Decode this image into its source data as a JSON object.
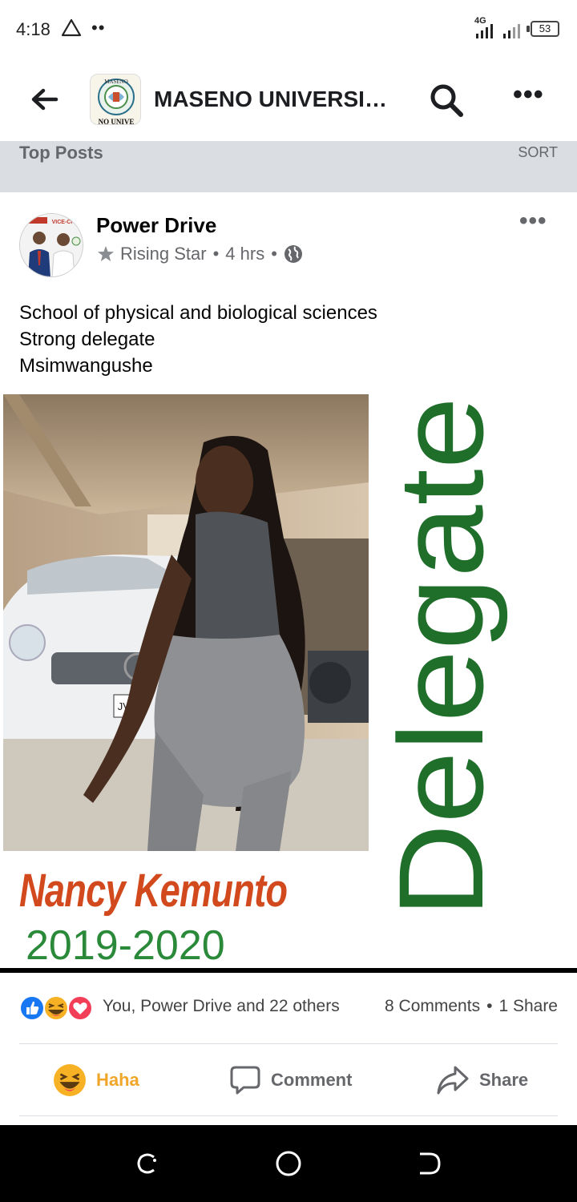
{
  "status_bar": {
    "time": "4:18",
    "dots": "••",
    "network": "4G",
    "battery": "53"
  },
  "header": {
    "title": "MASENO UNIVERSIT…",
    "logo_text_top": "MASENO",
    "logo_text_bottom": "NO UNIVE",
    "more": "•••"
  },
  "top_posts": {
    "label": "Top Posts",
    "sort": "SORT"
  },
  "post": {
    "author": "Power Drive",
    "badge": "Rising Star",
    "time": "4 hrs",
    "separator": "•",
    "more": "•••",
    "text_lines": [
      "School of physical and biological sciences",
      "Strong delegate",
      "Msimwangushe"
    ],
    "avatar_caption_left": "VICE-CH",
    "image": {
      "name": "Nancy Kemunto",
      "years": "2019-2020",
      "vertical_word": "Delegate",
      "plate": "JVN"
    },
    "reactions": {
      "summary": "You, Power Drive and 22 others",
      "comments": "8 Comments",
      "shares": "1 Share",
      "separator": "•"
    },
    "actions": {
      "haha": "Haha",
      "comment": "Comment",
      "share": "Share"
    }
  },
  "colors": {
    "facebook_blue": "#1877f2",
    "haha_yellow": "#f7b125",
    "love_red": "#f33e58",
    "name_orange": "#d2491d",
    "years_green": "#2a8a3a",
    "delegate_green": "#1f6e2a"
  }
}
